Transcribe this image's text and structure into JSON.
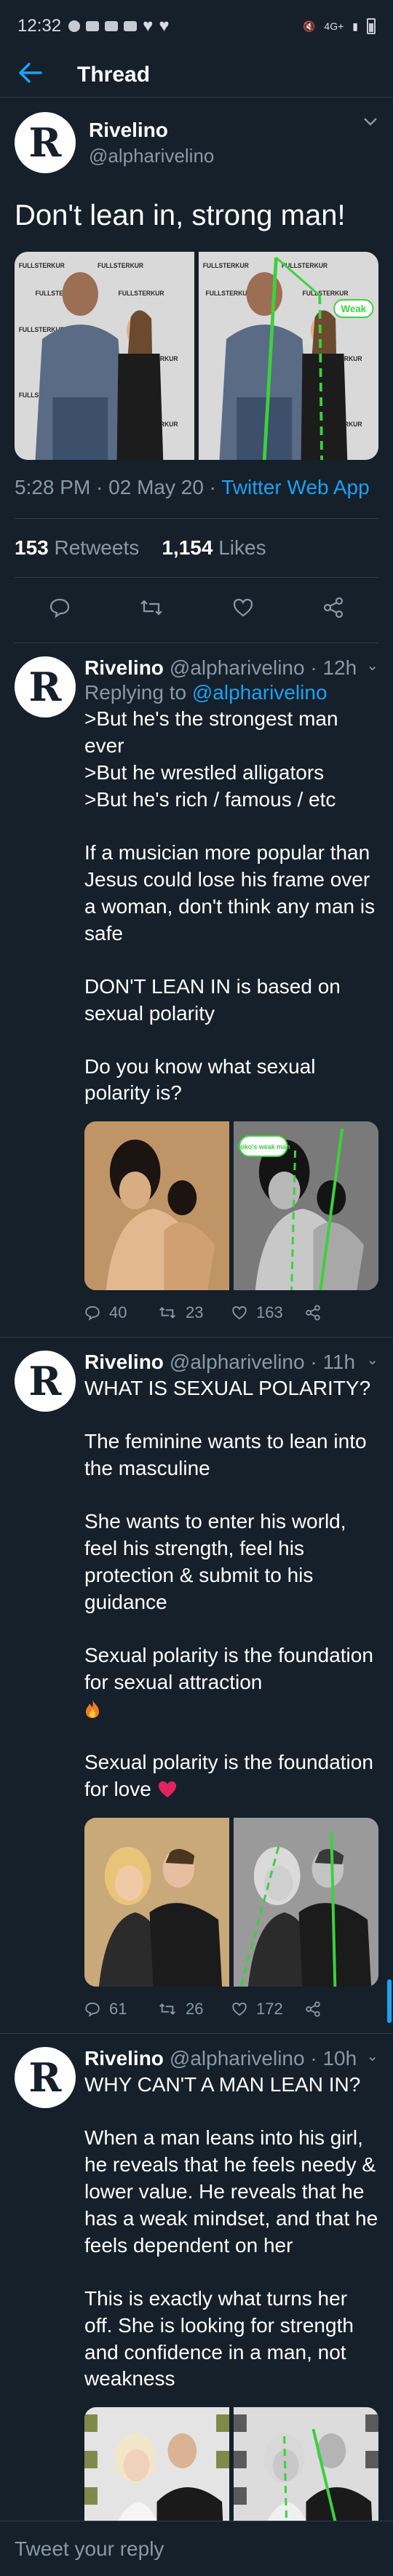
{
  "status_bar": {
    "time": "12:32",
    "network": "4G+"
  },
  "header": {
    "back_icon": "arrow-left-icon",
    "title": "Thread"
  },
  "main_tweet": {
    "author_name": "Rivelino",
    "author_handle": "@alpharivelino",
    "avatar_letter": "R",
    "text": "Don't lean in, strong man!",
    "image_overlay_label": "Weak",
    "timestamp": "5:28 PM · 02 May 20 · ",
    "client": "Twitter Web App",
    "retweets_count": "153",
    "retweets_label": "Retweets",
    "likes_count": "1,154",
    "likes_label": "Likes"
  },
  "replies": [
    {
      "author_name": "Rivelino",
      "author_handle": "@alpharivelino · 12h",
      "replying_prefix": "Replying to",
      "replying_to": "@alpharivelino",
      "paragraphs": [
        ">But he's the strongest man ever\n>But he wrestled alligators\n>But he's rich / famous / etc",
        "If a musician more popular than Jesus could lose his frame over a woman, don't think any man is safe",
        "DON'T LEAN IN is based on sexual polarity",
        "Do you know what sexual polarity is?"
      ],
      "image_overlay_label": "Yoko's weak man",
      "replies_count": "40",
      "retweets_count": "23",
      "likes_count": "163"
    },
    {
      "author_name": "Rivelino",
      "author_handle": "@alpharivelino · 11h",
      "paragraphs": [
        "WHAT IS SEXUAL POLARITY?",
        "The feminine wants to lean into the masculine",
        "She wants to enter his world, feel his strength, feel his protection & submit to his guidance",
        "Sexual polarity is the foundation for sexual attraction",
        "Sexual polarity is the foundation for love"
      ],
      "replies_count": "61",
      "retweets_count": "26",
      "likes_count": "172"
    },
    {
      "author_name": "Rivelino",
      "author_handle": "@alpharivelino · 10h",
      "paragraphs": [
        "WHY CAN'T A MAN LEAN IN?",
        "When a man leans into his girl, he reveals that he feels needy & lower value. He reveals that he has a weak mindset, and that he feels dependent on her",
        "This is exactly what turns her off. She is looking for strength and confidence in a man, not weakness"
      ]
    }
  ],
  "backdrop_text": "FULLSTERKUR",
  "composer": {
    "placeholder": "Tweet your reply"
  },
  "colors": {
    "background": "#15202b",
    "accent": "#1da1f2",
    "muted": "#8899a6",
    "divider": "#2f3d4b",
    "overlay_line": "#3cd13c"
  }
}
